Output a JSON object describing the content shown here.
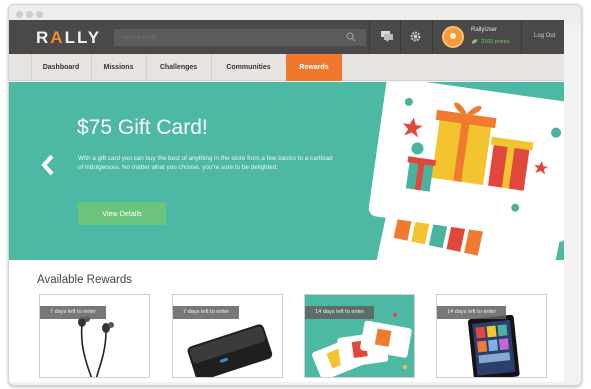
{
  "app": {
    "logo_prefix": "R",
    "logo_accent": "A",
    "logo_suffix": "LLY"
  },
  "search": {
    "placeholder": "Search Rally"
  },
  "user": {
    "name": "RallyUser",
    "points": "2100 points"
  },
  "header": {
    "logout_label": "Log Out"
  },
  "nav": {
    "tabs": [
      {
        "label": "Dashboard"
      },
      {
        "label": "Missions"
      },
      {
        "label": "Challenges"
      },
      {
        "label": "Communities"
      },
      {
        "label": "Rewards",
        "active": true
      }
    ]
  },
  "hero": {
    "title": "$75 Gift Card!",
    "description": "With a gift card you can buy the best of anything in the store from a few basics to a cartload of indulgences. No matter what you choose, you're sure to be delighted.",
    "button_label": "View Details"
  },
  "rewards": {
    "title": "Available Rewards",
    "cards": [
      {
        "badge": "7 days left to enter",
        "image": "earbuds"
      },
      {
        "badge": "7 days left to enter",
        "image": "external-hard-drive"
      },
      {
        "badge": "14 days left to enter",
        "image": "gift-cards"
      },
      {
        "badge": "14 days left to enter",
        "image": "tablet"
      }
    ]
  },
  "colors": {
    "accent": "#f0782d",
    "hero_bg": "#4db8a4",
    "button_green": "#6bc47a",
    "topbar": "#4a4848"
  }
}
